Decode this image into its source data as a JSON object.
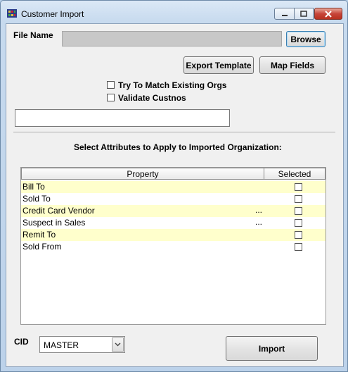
{
  "window": {
    "title": "Customer Import"
  },
  "file": {
    "label": "File Name",
    "value": "",
    "browse_label": "Browse"
  },
  "actions": {
    "export_template": "Export Template",
    "map_fields": "Map Fields"
  },
  "options": [
    {
      "label": "Try To Match Existing Orgs",
      "checked": false
    },
    {
      "label": "Validate Custnos",
      "checked": false
    }
  ],
  "status_field": {
    "value": ""
  },
  "section_title": "Select Attributes to Apply to Imported Organization:",
  "grid": {
    "columns": [
      "Property",
      "Selected"
    ],
    "rows": [
      {
        "name": "Bill To",
        "dots": "",
        "selected": false
      },
      {
        "name": "Sold To",
        "dots": "",
        "selected": false
      },
      {
        "name": "Credit Card Vendor",
        "dots": "...",
        "selected": false
      },
      {
        "name": "Suspect in Sales",
        "dots": "...",
        "selected": false
      },
      {
        "name": "Remit To",
        "dots": "",
        "selected": false
      },
      {
        "name": "Sold From",
        "dots": "",
        "selected": false
      }
    ]
  },
  "cid": {
    "label": "CID",
    "value": "MASTER"
  },
  "import_label": "Import",
  "icons": {
    "app": "grid-app-icon",
    "minimize": "minimize-icon",
    "maximize": "maximize-icon",
    "close": "close-icon",
    "dropdown": "chevron-down-icon"
  },
  "colors": {
    "row_highlight": "#ffffcc",
    "close_button": "#c7453a"
  }
}
